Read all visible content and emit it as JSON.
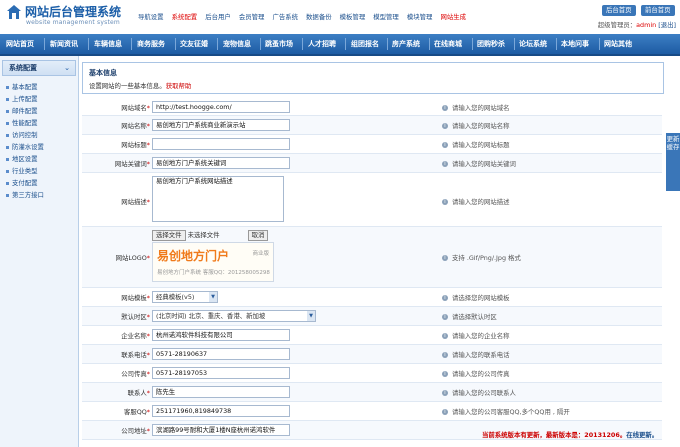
{
  "header": {
    "logo_title": "网站后台管理系统",
    "logo_sub": "website management system",
    "topnav": [
      {
        "label": "导航设置",
        "red": false
      },
      {
        "label": "系统配置",
        "red": true
      },
      {
        "label": "后台用户",
        "red": false
      },
      {
        "label": "会员管理",
        "red": false
      },
      {
        "label": "广告系统",
        "red": false
      },
      {
        "label": "数据备份",
        "red": false
      },
      {
        "label": "模板管理",
        "red": false
      },
      {
        "label": "模型管理",
        "red": false
      },
      {
        "label": "模块管理",
        "red": false
      },
      {
        "label": "网站生成",
        "red": true
      }
    ],
    "home_button": "后台首页",
    "site_button": "前台首页",
    "user_prefix": "超级管理员：",
    "user_name": "admin",
    "logout": "[退出]"
  },
  "mainnav": [
    "网站首页",
    "新闻资讯",
    "车辆信息",
    "商务服务",
    "交友征婚",
    "宠物信息",
    "跳蚤市场",
    "人才招聘",
    "组团报名",
    "房产系统",
    "在线商城",
    "团购秒杀",
    "论坛系统",
    "本地问事",
    "网站其他"
  ],
  "sidebar": {
    "title": "系统配置",
    "items": [
      "基本配置",
      "上传配置",
      "邮件配置",
      "性能配置",
      "访问控制",
      "防灌水设置",
      "地区设置",
      "行业类型",
      "支付配置",
      "第三方接口"
    ]
  },
  "info": {
    "title": "基本信息",
    "desc_prefix": "设置网站的一些基本信息。",
    "desc_link": "获取帮助"
  },
  "form": {
    "site_domain": {
      "label": "网站域名",
      "value": "http://test.hoogge.com/",
      "hint": "请输入您的网站域名"
    },
    "site_name": {
      "label": "网站名称",
      "value": "易创地方门户系统商业新演示站",
      "hint": "请输入您的网站名称"
    },
    "site_title": {
      "label": "网站标题",
      "value": "",
      "hint": "请输入您的网站标题"
    },
    "site_keywords": {
      "label": "网站关键词",
      "value": "易创地方门户系统关键词",
      "hint": "请输入您的网站关键词"
    },
    "site_desc": {
      "label": "网站描述",
      "value": "易创地方门户系统网站描述",
      "hint": "请输入您的网站描述"
    },
    "site_logo": {
      "label": "网站LOGO",
      "file_button": "选择文件",
      "file_status": "未选择文件",
      "cancel": "取消",
      "logo_text": "易创地方门户",
      "logo_tag": "商业版",
      "logo_sub": "易创地方门户系统  客服QQ：201258005298",
      "hint": "支持 .Gif/Png/.Jpg 格式"
    },
    "site_template": {
      "label": "网站模板",
      "value": "经典模板(v5)",
      "hint": "请选择您的网站模板"
    },
    "timezone": {
      "label": "默认时区",
      "value": "(北京时间) 北京、重庆、香港、新加坡",
      "hint": "请选择默认时区"
    },
    "company": {
      "label": "企业名称",
      "value": "杭州诺鸿软件科技有限公司",
      "hint": "请输入您的企业名称"
    },
    "phone": {
      "label": "联系电话",
      "value": "0571-28190637",
      "hint": "请输入您的联系电话"
    },
    "fax": {
      "label": "公司传真",
      "value": "0571-28197053",
      "hint": "请输入您的公司传真"
    },
    "contact": {
      "label": "联系人",
      "value": "陈先生",
      "hint": "请输入您的公司联系人"
    },
    "qq": {
      "label": "客服QQ",
      "value": "251171960,819849738",
      "hint": "请输入您的公司客服QQ,多个QQ用 , 隔开"
    },
    "address": {
      "label": "公司地址",
      "value": "滨湖路99号耐和大厦1楼N座杭州诺鸿软件"
    }
  },
  "rib": "更新缓存",
  "update_notice": {
    "text": "当前系统版本有更新，最新版本是：20131206。",
    "link": "在线更新。"
  }
}
